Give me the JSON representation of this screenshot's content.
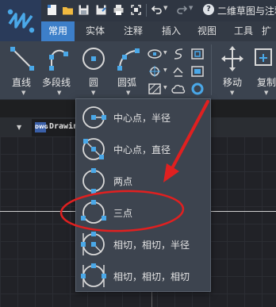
{
  "title_bar": {
    "document_title": "二维草图与注释",
    "help_glyph": "?"
  },
  "tabs": [
    {
      "label": "常用",
      "active": true
    },
    {
      "label": "实体",
      "active": false
    },
    {
      "label": "注释",
      "active": false
    },
    {
      "label": "插入",
      "active": false
    },
    {
      "label": "视图",
      "active": false
    },
    {
      "label": "工具",
      "active": false
    },
    {
      "label": "扩",
      "active": false
    }
  ],
  "ribbon": {
    "line_label": "直线",
    "polyline_label": "多段线",
    "circle_label": "圆",
    "arc_label": "圆弧",
    "move_label": "移动",
    "copy_label": "复制"
  },
  "document_tab": {
    "filename": "Drawing1.dwg",
    "badge": "DWG",
    "close_glyph": "✕"
  },
  "circle_menu": {
    "items": [
      {
        "label": "中心点，半径",
        "icon": "circle-center-radius-icon"
      },
      {
        "label": "中心点，直径",
        "icon": "circle-center-diameter-icon"
      },
      {
        "label": "两点",
        "icon": "circle-2-point-icon"
      },
      {
        "label": "三点",
        "icon": "circle-3-point-icon"
      },
      {
        "label": "相切，相切，半径",
        "icon": "circle-tan-tan-radius-icon"
      },
      {
        "label": "相切，相切，相切",
        "icon": "circle-tan-tan-tan-icon"
      }
    ],
    "highlighted": "三点"
  },
  "colors": {
    "accent_blue": "#3d7fc9",
    "annotation_red": "#e02020",
    "icon_blue": "#4aa8e8"
  }
}
